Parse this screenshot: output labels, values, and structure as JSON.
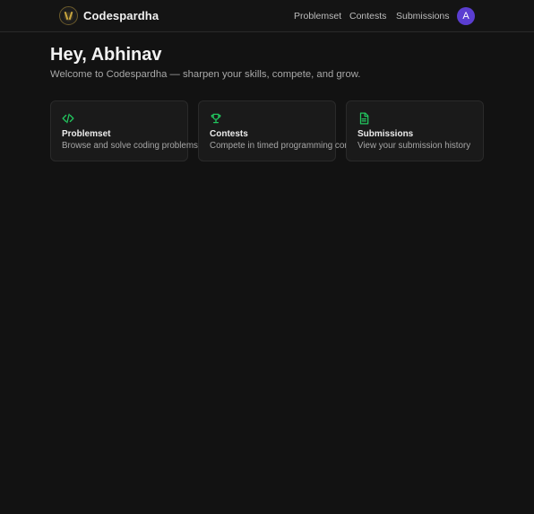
{
  "header": {
    "brand": "Codespardha",
    "nav": [
      "Problemset",
      "Contests",
      "Submissions"
    ],
    "avatar_initial": "A"
  },
  "main": {
    "greeting": "Hey, Abhinav",
    "subtitle": "Welcome to Codespardha — sharpen your skills, compete, and grow.",
    "cards": [
      {
        "icon": "code-icon",
        "title": "Problemset",
        "description": "Browse and solve coding problems"
      },
      {
        "icon": "trophy-icon",
        "title": "Contests",
        "description": "Compete in timed programming contests"
      },
      {
        "icon": "document-icon",
        "title": "Submissions",
        "description": "View your submission history"
      }
    ]
  },
  "colors": {
    "background": "#121212",
    "card_background": "#1a1a1a",
    "accent_green": "#22c55e",
    "avatar": "#5b3ed1"
  }
}
